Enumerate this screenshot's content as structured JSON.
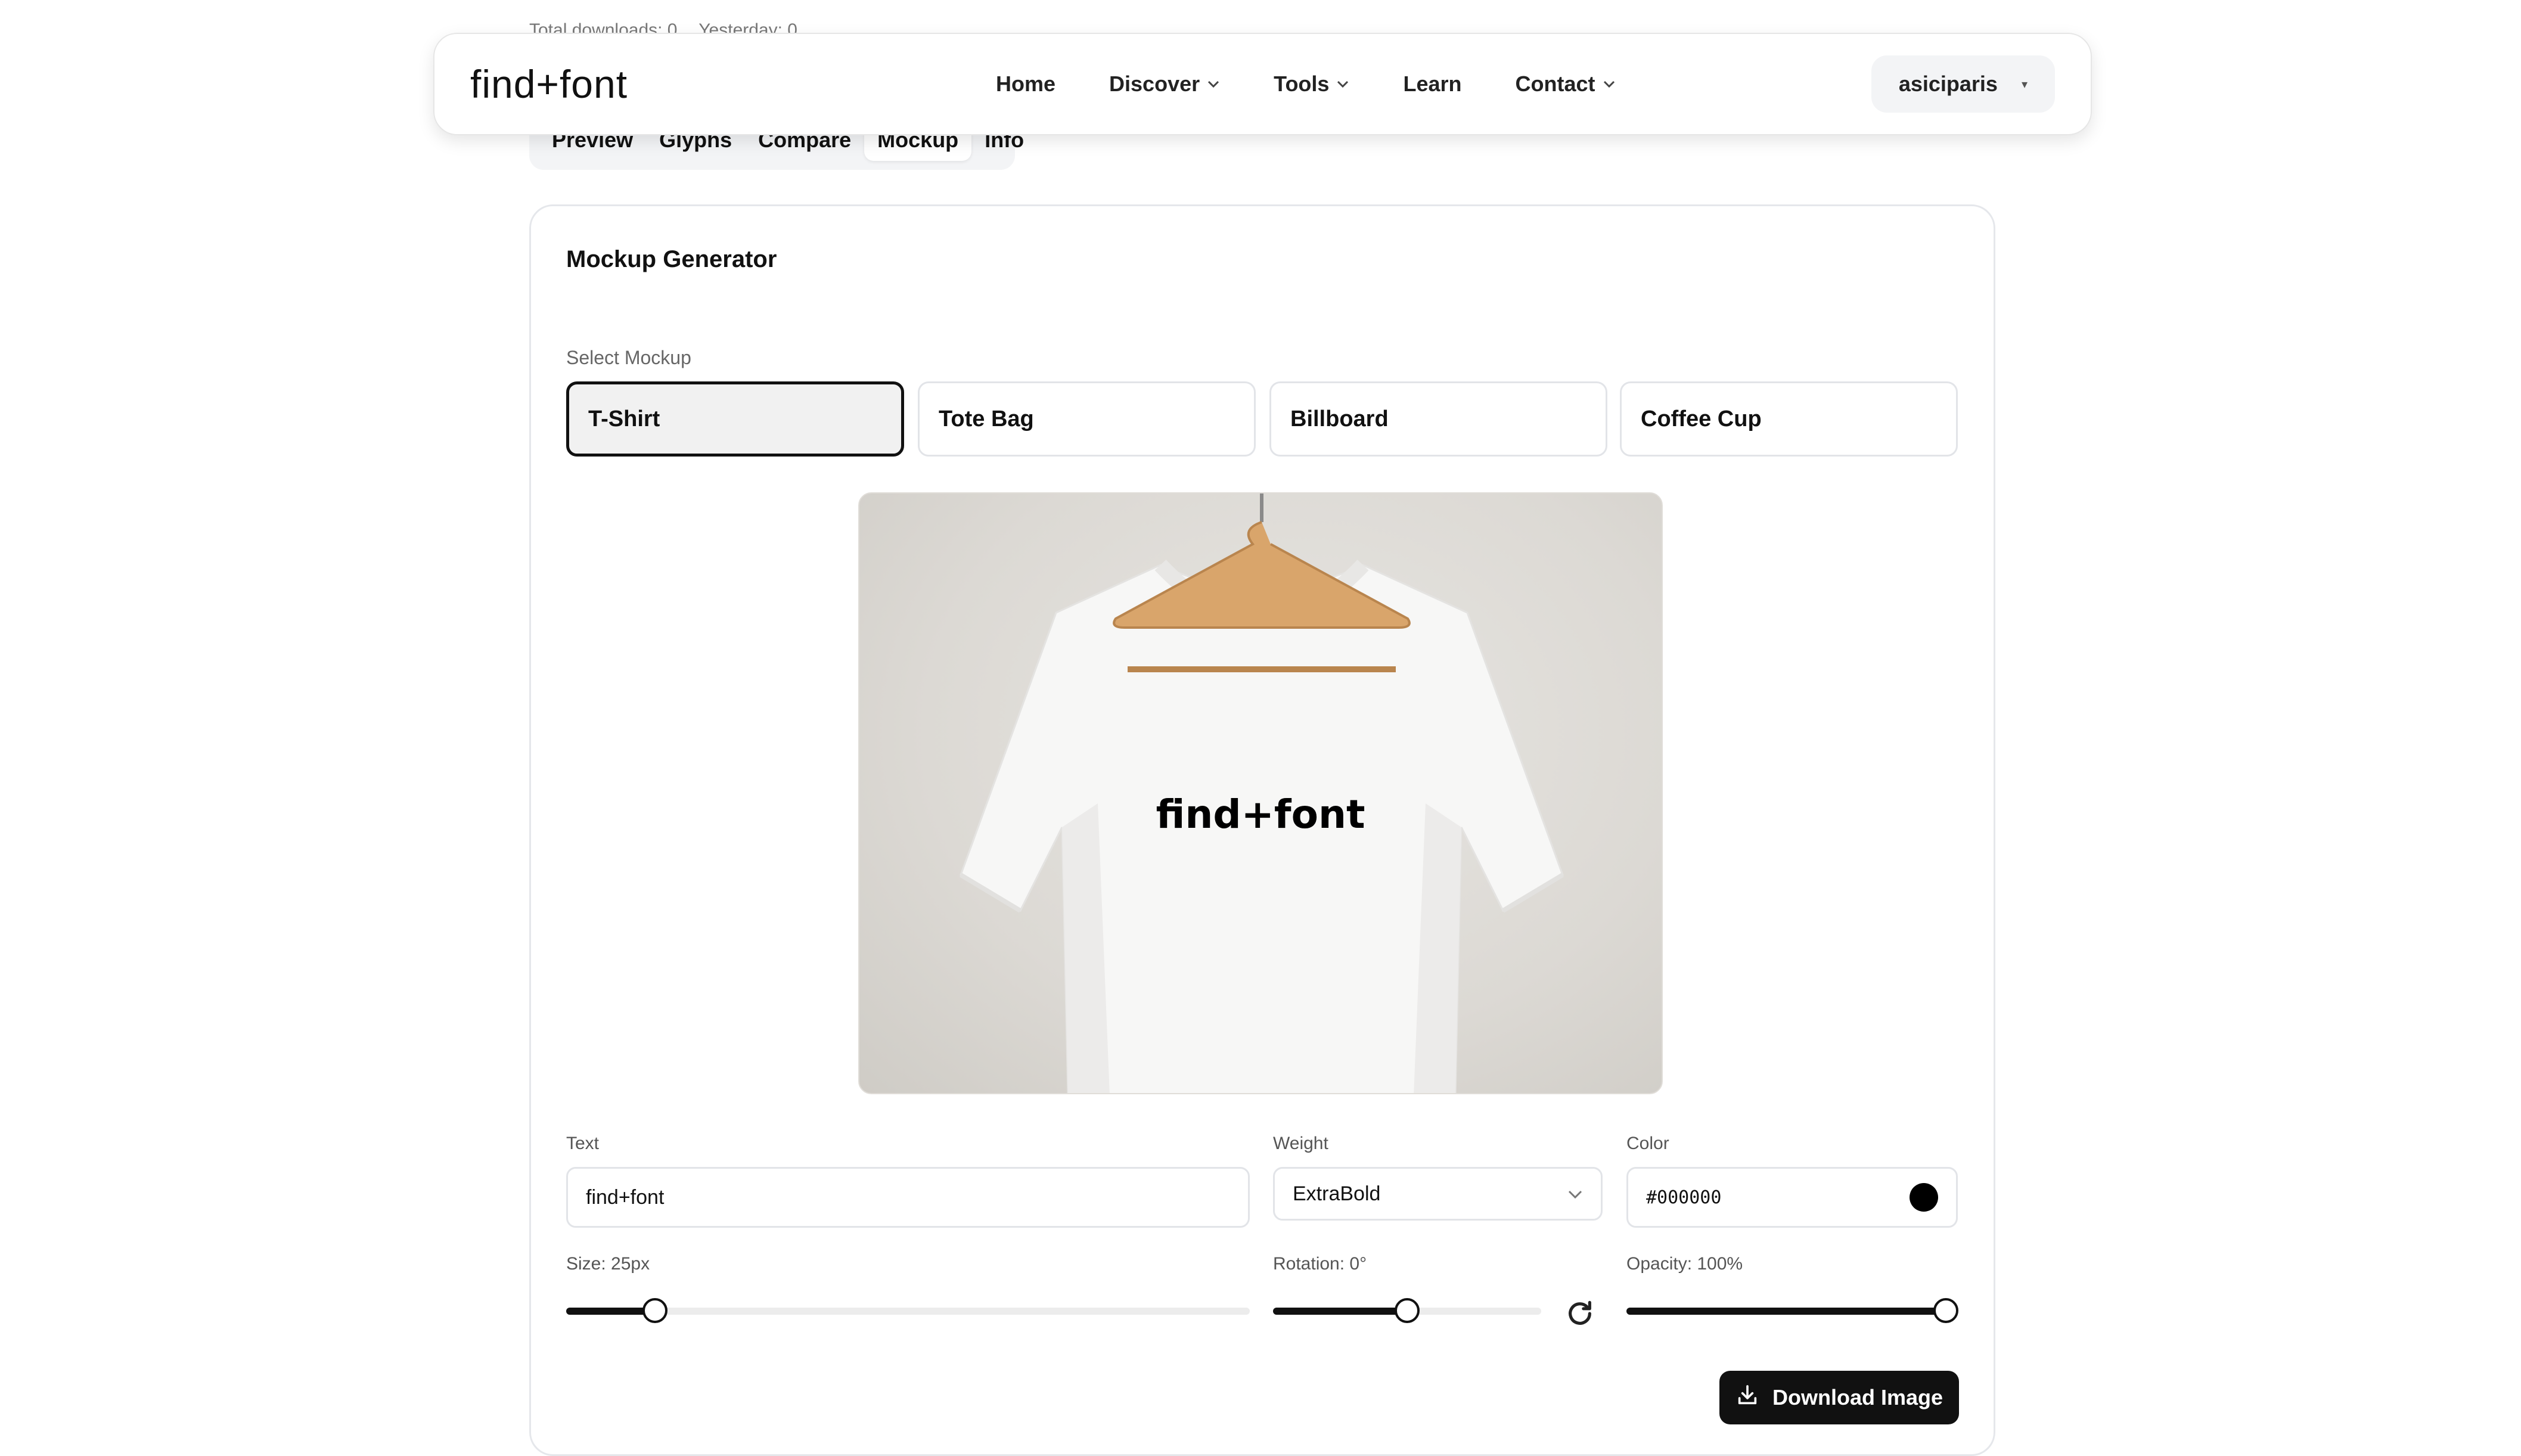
{
  "stats": {
    "total_downloads": "Total downloads: 0",
    "yesterday": "Yesterday: 0"
  },
  "header": {
    "logo": "find+font",
    "nav": [
      {
        "label": "Home",
        "has_dropdown": false
      },
      {
        "label": "Discover",
        "has_dropdown": true
      },
      {
        "label": "Tools",
        "has_dropdown": true
      },
      {
        "label": "Learn",
        "has_dropdown": false
      },
      {
        "label": "Contact",
        "has_dropdown": true
      }
    ],
    "user": "asiciparis",
    "user_caret": "▾",
    "chevron": "⌄"
  },
  "tabs": [
    {
      "label": "Preview",
      "active": false
    },
    {
      "label": "Glyphs",
      "active": false
    },
    {
      "label": "Compare",
      "active": false
    },
    {
      "label": "Mockup",
      "active": true
    },
    {
      "label": "Info",
      "active": false
    }
  ],
  "card": {
    "title": "Mockup Generator",
    "select_label": "Select Mockup",
    "options": [
      {
        "label": "T-Shirt",
        "selected": true
      },
      {
        "label": "Tote Bag",
        "selected": false
      },
      {
        "label": "Billboard",
        "selected": false
      },
      {
        "label": "Coffee Cup",
        "selected": false
      }
    ],
    "mockup_text": "find+font"
  },
  "controls": {
    "text_label": "Text",
    "text_value": "find+font",
    "weight_label": "Weight",
    "weight_value": "ExtraBold",
    "color_label": "Color",
    "color_value": "#000000",
    "size_label": "Size: 25px",
    "size_fraction": 0.13,
    "rotation_label": "Rotation: 0°",
    "rotation_fraction": 0.5,
    "opacity_label": "Opacity: 100%",
    "opacity_fraction": 1.0,
    "download_label": "Download Image"
  },
  "icons": {
    "reset": "refresh-icon",
    "download": "download-icon",
    "chevron": "chevron-down-icon"
  },
  "colors": {
    "accent": "#111111",
    "swatch": "#000000",
    "tab_bg": "#f3f4f6"
  }
}
